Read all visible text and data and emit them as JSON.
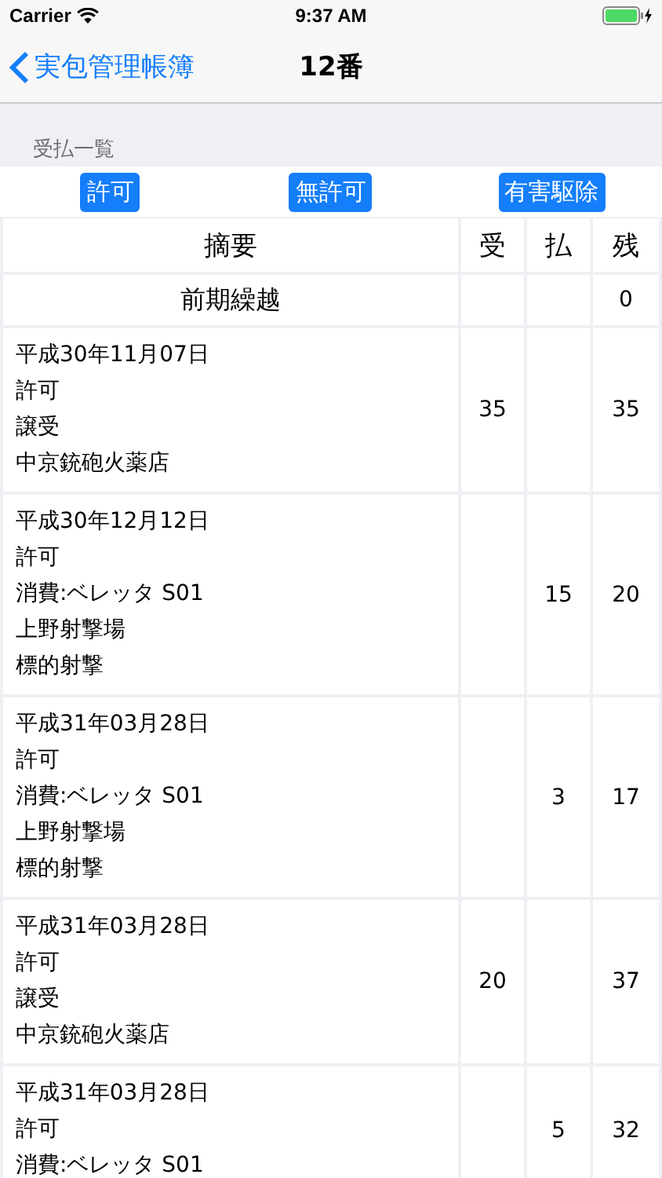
{
  "status_bar": {
    "carrier": "Carrier",
    "time": "9:37 AM"
  },
  "nav": {
    "back": "実包管理帳簿",
    "title": "12番"
  },
  "section": {
    "title": "受払一覧"
  },
  "filters": [
    {
      "label": "許可"
    },
    {
      "label": "無許可"
    },
    {
      "label": "有害駆除"
    }
  ],
  "table": {
    "columns": [
      "摘要",
      "受",
      "払",
      "残"
    ],
    "rows": [
      {
        "kind": "carry",
        "summary": "前期繰越",
        "balance": "0"
      },
      {
        "kind": "entry",
        "lines": [
          "平成30年11月07日",
          "許可",
          "譲受",
          "中京銃砲火薬店"
        ],
        "in": "35",
        "balance": "35"
      },
      {
        "kind": "entry",
        "lines": [
          "平成30年12月12日",
          "許可",
          "消費:ベレッタ S01",
          "上野射撃場",
          "標的射撃"
        ],
        "out": "15",
        "balance": "20"
      },
      {
        "kind": "entry",
        "lines": [
          "平成31年03月28日",
          "許可",
          "消費:ベレッタ S01",
          "上野射撃場",
          "標的射撃"
        ],
        "out": "3",
        "balance": "17"
      },
      {
        "kind": "entry",
        "lines": [
          "平成31年03月28日",
          "許可",
          "譲受",
          "中京銃砲火薬店"
        ],
        "in": "20",
        "balance": "37"
      },
      {
        "kind": "entry",
        "lines": [
          "平成31年03月28日",
          "許可",
          "消費:ベレッタ S01"
        ],
        "out": "5",
        "balance": "32"
      }
    ]
  }
}
